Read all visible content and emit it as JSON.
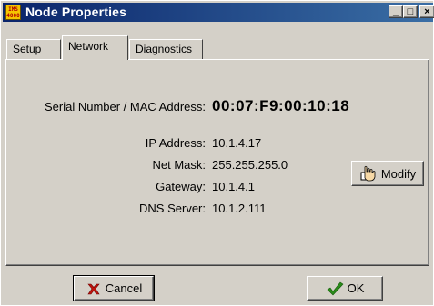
{
  "window": {
    "title": "Node Properties",
    "app_icon_text": "IMS\n4000"
  },
  "title_controls": {
    "minimize": "_",
    "maximize": "□",
    "close": "×"
  },
  "tabs": [
    {
      "label": "Setup"
    },
    {
      "label": "Network"
    },
    {
      "label": "Diagnostics"
    }
  ],
  "network": {
    "mac": {
      "label": "Serial Number / MAC Address:",
      "value": "00:07:F9:00:10:18"
    },
    "ip": {
      "label": "IP Address:",
      "value": "10.1.4.17"
    },
    "netmask": {
      "label": "Net Mask:",
      "value": "255.255.255.0"
    },
    "gateway": {
      "label": "Gateway:",
      "value": "10.1.4.1"
    },
    "dns": {
      "label": "DNS Server:",
      "value": "10.1.2.111"
    }
  },
  "buttons": {
    "modify": "Modify",
    "cancel": "Cancel",
    "ok": "OK"
  },
  "colors": {
    "titlebar_start": "#0a246a",
    "titlebar_end": "#3a6ea5",
    "face": "#d4d0c8",
    "cancel_x": "#c0140c",
    "ok_check": "#2a8a1a"
  }
}
